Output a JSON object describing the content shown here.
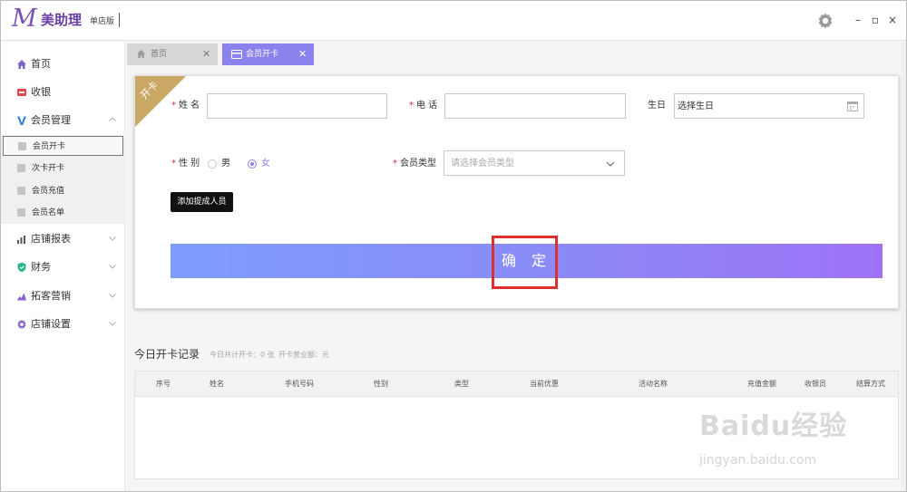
{
  "app": {
    "logo_letter": "M",
    "name": "美助理",
    "edition": "单店版"
  },
  "window_controls": {
    "minimize": "–",
    "maximize": "▫",
    "close": "×"
  },
  "sidebar": {
    "items": [
      {
        "label": "首页",
        "icon": "home-icon"
      },
      {
        "label": "收银",
        "icon": "cashier-icon"
      },
      {
        "label": "会员管理",
        "icon": "member-v-icon"
      },
      {
        "label": "店铺报表",
        "icon": "bar-chart-icon"
      },
      {
        "label": "财务",
        "icon": "shield-icon"
      },
      {
        "label": "拓客营销",
        "icon": "marketing-icon"
      },
      {
        "label": "店铺设置",
        "icon": "gear-icon"
      }
    ],
    "member_sub_items": [
      {
        "label": "会员开卡",
        "active": true
      },
      {
        "label": "次卡开卡",
        "active": false
      },
      {
        "label": "会员充值",
        "active": false
      },
      {
        "label": "会员名单",
        "active": false
      }
    ]
  },
  "tabs": [
    {
      "label": "首页",
      "icon": "home-icon",
      "active": false
    },
    {
      "label": "会员开卡",
      "icon": "card-icon",
      "active": true
    }
  ],
  "form": {
    "ribbon": "开卡",
    "name_label": "姓 名",
    "phone_label": "电 话",
    "birthday_label": "生日",
    "birthday_value": "选择生日",
    "gender_label": "性 别",
    "gender_options": [
      "男",
      "女"
    ],
    "gender_selected": "女",
    "member_type_label": "会员类型",
    "member_type_placeholder": "请选择会员类型",
    "add_staff_button": "添加提成人员",
    "confirm_button": "确 定",
    "required_mark": "*"
  },
  "records": {
    "title": "今日开卡记录",
    "total_cards": "今日共计开卡：0 张",
    "total_amount": "开卡营业额：元",
    "columns": [
      "序号",
      "姓名",
      "手机号码",
      "性别",
      "类型",
      "当前优惠",
      "活动名称",
      "充值金额",
      "收银员",
      "结算方式"
    ]
  },
  "watermark": {
    "brand": "Baidu经验",
    "url": "jingyan.baidu.com"
  },
  "colors": {
    "brand_purple": "#6a3ea1",
    "tab_active": "#8a83ee",
    "ribbon_gold": "#c8a864",
    "required_red": "#e0282e",
    "highlight_red": "#e02d2d",
    "confirm_gradient_start": "#7d9cfb",
    "confirm_gradient_end": "#9e72f7"
  }
}
